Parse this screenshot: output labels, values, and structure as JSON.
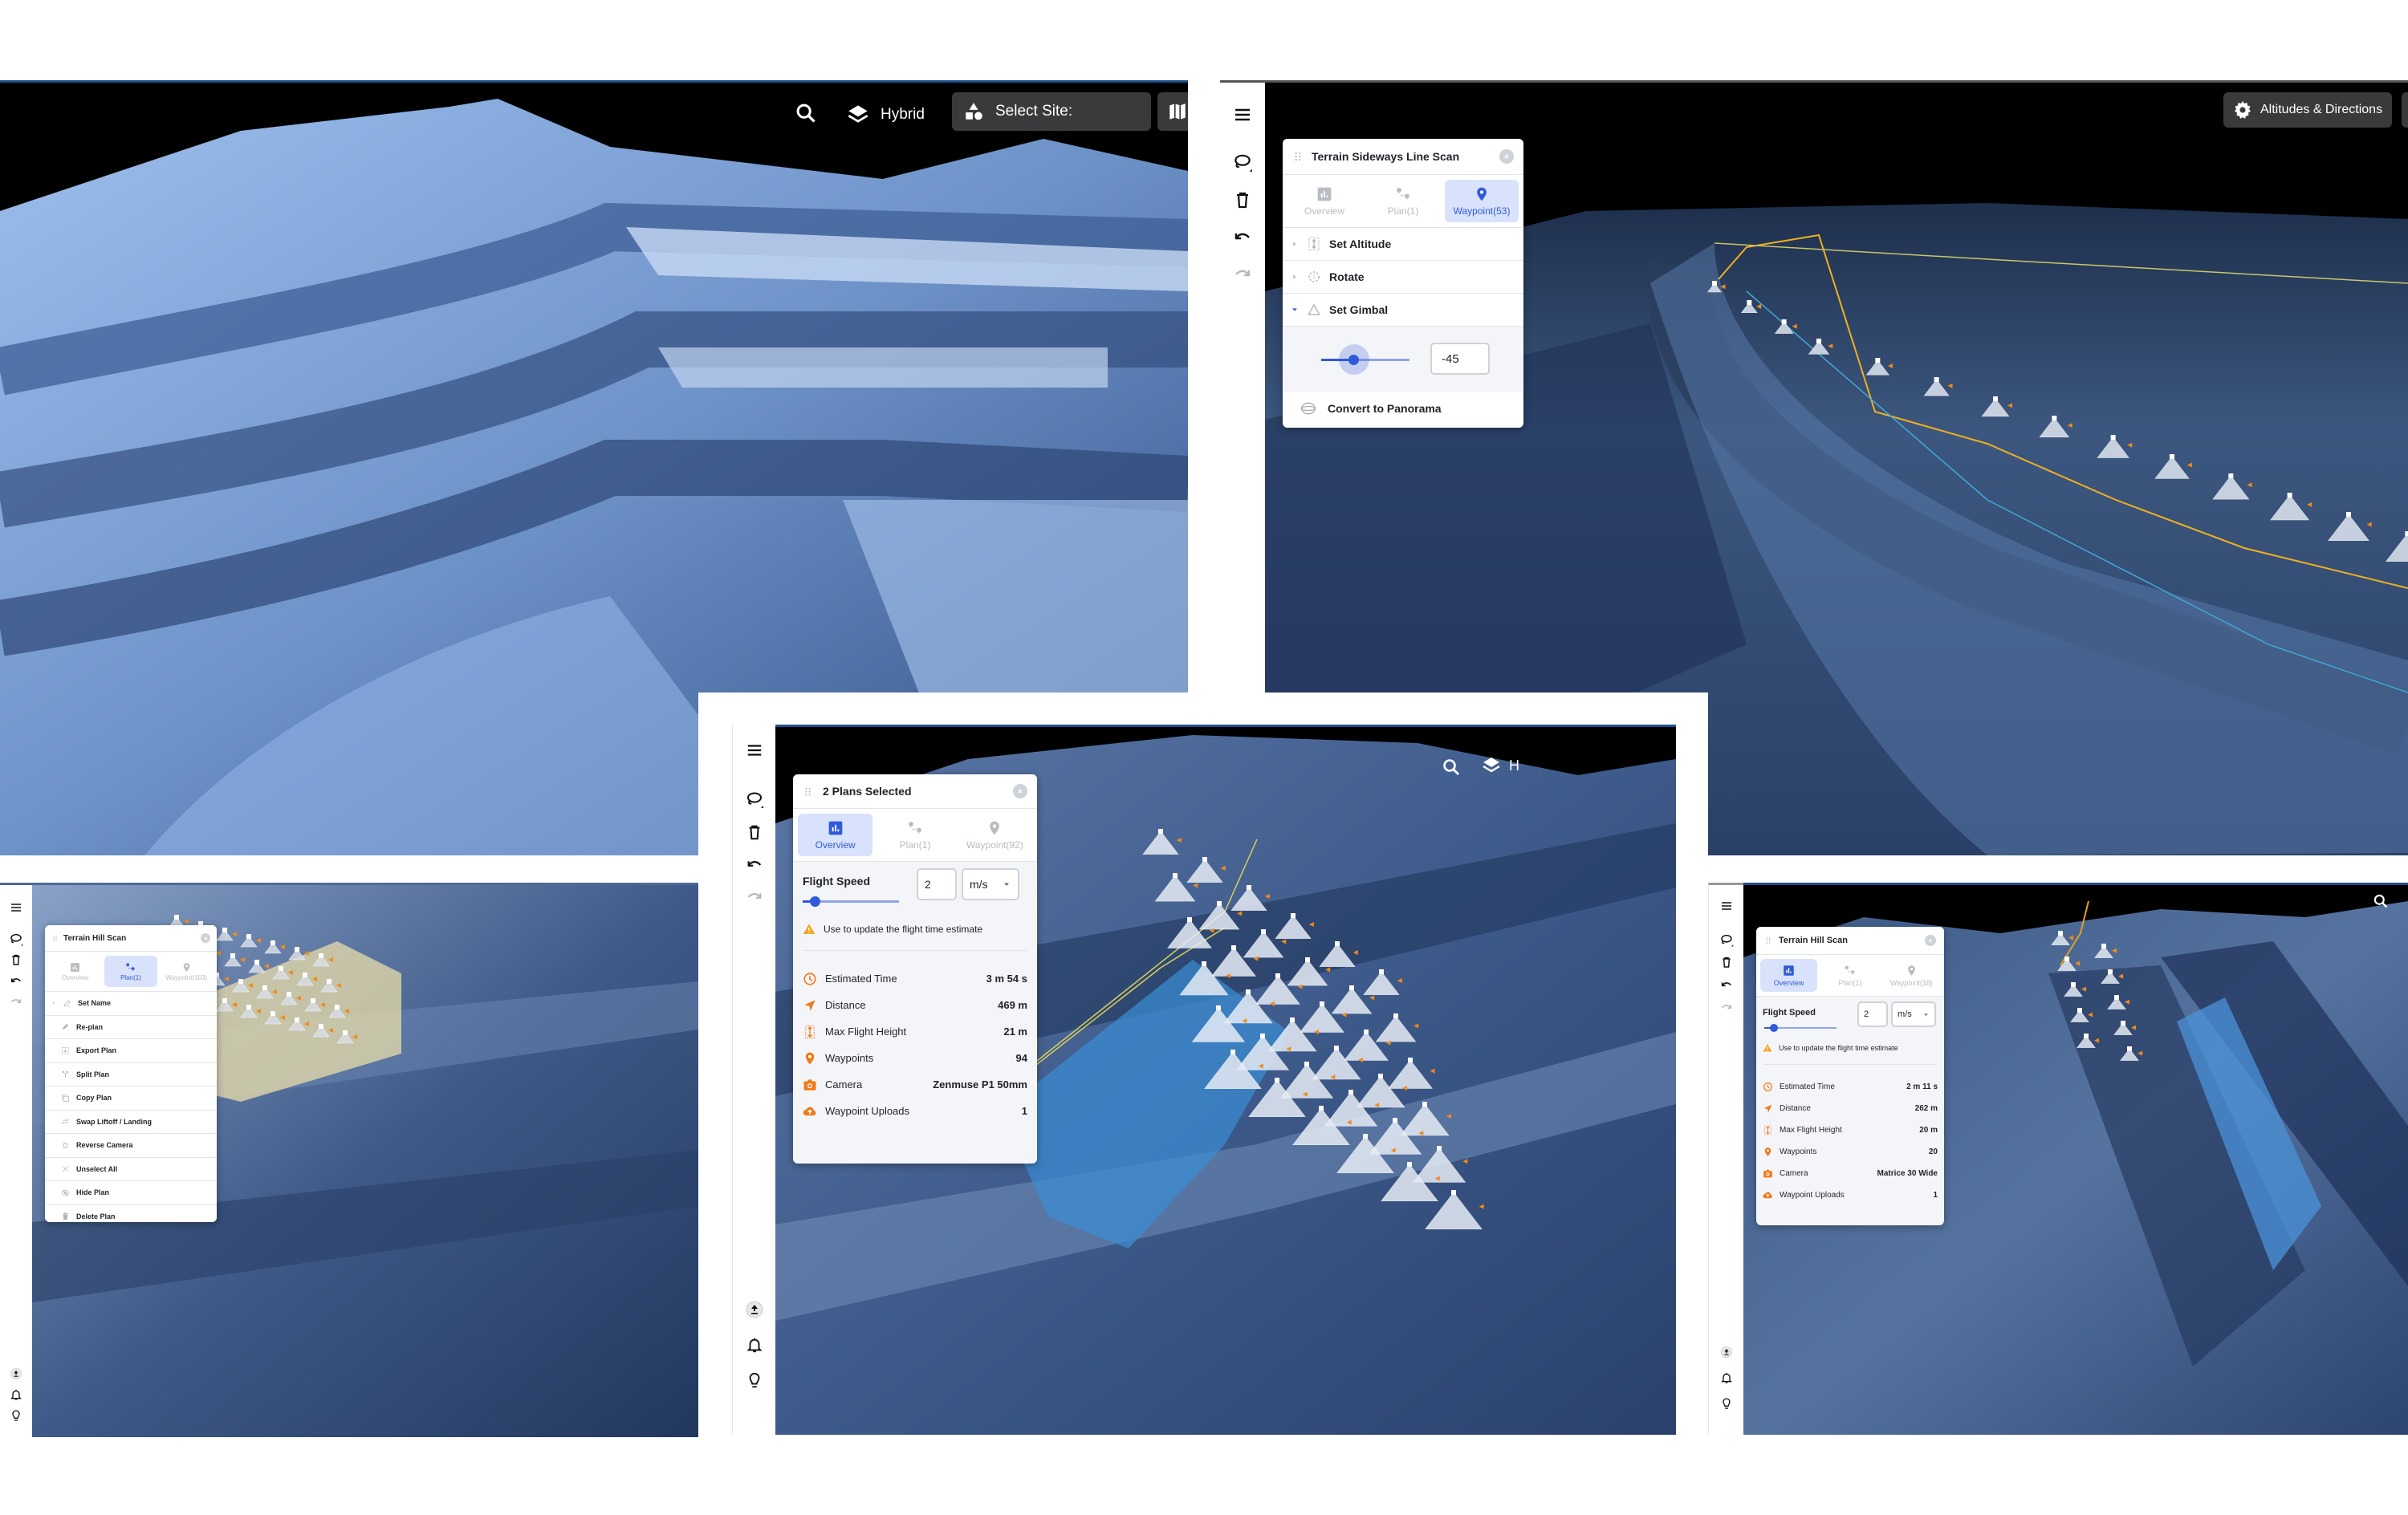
{
  "colors": {
    "accent": "#2f5ad9",
    "accent_bg": "#d9e2fb",
    "stat_icon": "#f07a1a",
    "terrain_light": "#8fb2e6",
    "terrain_dark": "#34507f",
    "panel_bg": "#f4f5f8",
    "toolbar_btn_bg": "#3a3a3c"
  },
  "screen_top_left": {
    "toolbar": {
      "search_icon": "search-icon",
      "layers_label": "Hybrid",
      "site_label": "Select Site:",
      "map_icon": "map-icon"
    }
  },
  "screen_top_right": {
    "altitudes_label": "Altitudes & Directions",
    "panel": {
      "title": "Terrain Sideways Line Scan",
      "tabs": [
        {
          "label": "Overview",
          "icon": "bar-chart-icon",
          "active": false
        },
        {
          "label": "Plan(1)",
          "icon": "plan-route-icon",
          "active": false
        },
        {
          "label": "Waypoint(53)",
          "icon": "map-pin-icon",
          "active": true
        }
      ],
      "rows": [
        {
          "label": "Set Altitude",
          "icon": "altitude-icon",
          "expanded": false
        },
        {
          "label": "Rotate",
          "icon": "rotate-icon",
          "expanded": false
        },
        {
          "label": "Set Gimbal",
          "icon": "gimbal-icon",
          "expanded": true
        }
      ],
      "gimbal_value": "-45",
      "gimbal_slider_fraction": 0.37,
      "panorama_label": "Convert to Panorama"
    }
  },
  "screen_bottom_left": {
    "panel": {
      "title": "Terrain Hill Scan",
      "tabs": [
        {
          "label": "Overview",
          "active": false
        },
        {
          "label": "Plan(1)",
          "active": true
        },
        {
          "label": "Waypoint(103)",
          "active": false
        }
      ],
      "menu": [
        {
          "label": "Set Name",
          "icon": "rename-icon",
          "has_arrow": true
        },
        {
          "label": "Re-plan",
          "icon": "pencil-icon"
        },
        {
          "label": "Export Plan",
          "icon": "export-icon"
        },
        {
          "label": "Split Plan",
          "icon": "split-icon"
        },
        {
          "label": "Copy Plan",
          "icon": "copy-icon"
        },
        {
          "label": "Swap Liftoff / Landing",
          "icon": "swap-icon"
        },
        {
          "label": "Reverse Camera",
          "icon": "reverse-camera-icon"
        },
        {
          "label": "Unselect All",
          "icon": "close-x-icon"
        },
        {
          "label": "Hide Plan",
          "icon": "eye-off-icon"
        },
        {
          "label": "Delete Plan",
          "icon": "trash-icon"
        }
      ]
    }
  },
  "screen_bottom_center": {
    "toolbar": {
      "layers_label": "H"
    },
    "panel": {
      "title": "2 Plans Selected",
      "tabs": [
        {
          "label": "Overview",
          "active": true
        },
        {
          "label": "Plan(1)",
          "active": false
        },
        {
          "label": "Waypoint(92)",
          "active": false
        }
      ],
      "flight_speed_label": "Flight Speed",
      "flight_speed_value": "2",
      "flight_speed_unit": "m/s",
      "flight_speed_slider_fraction": 0.13,
      "warning": "Use to update the flight time estimate",
      "stats": [
        {
          "label": "Estimated Time",
          "value": "3 m 54 s",
          "icon": "clock-icon"
        },
        {
          "label": "Distance",
          "value": "469 m",
          "icon": "navigation-arrow-icon"
        },
        {
          "label": "Max Flight Height",
          "value": "21 m",
          "icon": "height-icon"
        },
        {
          "label": "Waypoints",
          "value": "94",
          "icon": "map-pin-icon"
        },
        {
          "label": "Camera",
          "value": "Zenmuse P1 50mm",
          "icon": "camera-icon"
        },
        {
          "label": "Waypoint Uploads",
          "value": "1",
          "icon": "cloud-upload-icon"
        }
      ]
    }
  },
  "screen_bottom_right": {
    "panel": {
      "title": "Terrain Hill Scan",
      "tabs": [
        {
          "label": "Overview",
          "active": true
        },
        {
          "label": "Plan(1)",
          "active": false
        },
        {
          "label": "Waypoint(18)",
          "active": false
        }
      ],
      "flight_speed_label": "Flight Speed",
      "flight_speed_value": "2",
      "flight_speed_unit": "m/s",
      "flight_speed_slider_fraction": 0.13,
      "warning": "Use to update the flight time estimate",
      "stats": [
        {
          "label": "Estimated Time",
          "value": "2 m 11 s",
          "icon": "clock-icon"
        },
        {
          "label": "Distance",
          "value": "262 m",
          "icon": "navigation-arrow-icon"
        },
        {
          "label": "Max Flight Height",
          "value": "20 m",
          "icon": "height-icon"
        },
        {
          "label": "Waypoints",
          "value": "20",
          "icon": "map-pin-icon"
        },
        {
          "label": "Camera",
          "value": "Matrice 30 Wide",
          "icon": "camera-icon"
        },
        {
          "label": "Waypoint Uploads",
          "value": "1",
          "icon": "cloud-upload-icon"
        }
      ]
    }
  }
}
